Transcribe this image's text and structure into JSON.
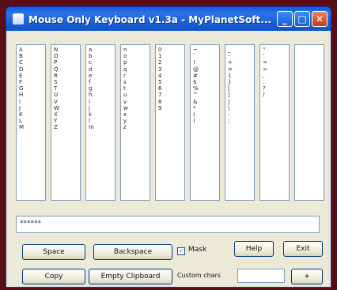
{
  "window": {
    "title": "Mouse Only Keyboard v1.3a - MyPlanetSoft...",
    "min_glyph": "_",
    "max_glyph": "□",
    "close_glyph": "✕"
  },
  "columns": [
    [
      "A",
      "B",
      "C",
      "D",
      "E",
      "F",
      "G",
      "H",
      "I",
      "J",
      "K",
      "L",
      "M"
    ],
    [
      "N",
      "O",
      "P",
      "Q",
      "R",
      "S",
      "T",
      "U",
      "V",
      "W",
      "X",
      "Y",
      "Z"
    ],
    [
      "a",
      "b",
      "c",
      "d",
      "e",
      "f",
      "g",
      "h",
      "i",
      "j",
      "k",
      "l",
      "m"
    ],
    [
      "n",
      "o",
      "p",
      "q",
      "r",
      "s",
      "t",
      "u",
      "v",
      "w",
      "x",
      "y",
      "z"
    ],
    [
      "0",
      "1",
      "2",
      "3",
      "4",
      "5",
      "6",
      "7",
      "8",
      "9"
    ],
    [
      "~",
      "`",
      "!",
      "@",
      "#",
      "$",
      "%",
      "^",
      "&",
      "*",
      "(",
      ")"
    ],
    [
      "_",
      "-",
      "+",
      "=",
      "{",
      "}",
      "[",
      "]",
      "|",
      "\\",
      ":",
      ";"
    ],
    [
      "\"",
      "'",
      "<",
      ">",
      ",",
      ".",
      "?",
      "/"
    ],
    []
  ],
  "output": {
    "text": "******"
  },
  "buttons": {
    "space": "Space",
    "backspace": "Backspace",
    "help": "Help",
    "exit": "Exit",
    "copy": "Copy",
    "empty_clipboard": "Empty Clipboard",
    "custom_add": "+"
  },
  "mask": {
    "label": "Mask",
    "checked_glyph": "✓"
  },
  "custom_chars": {
    "label": "Custom chars",
    "value": ""
  }
}
